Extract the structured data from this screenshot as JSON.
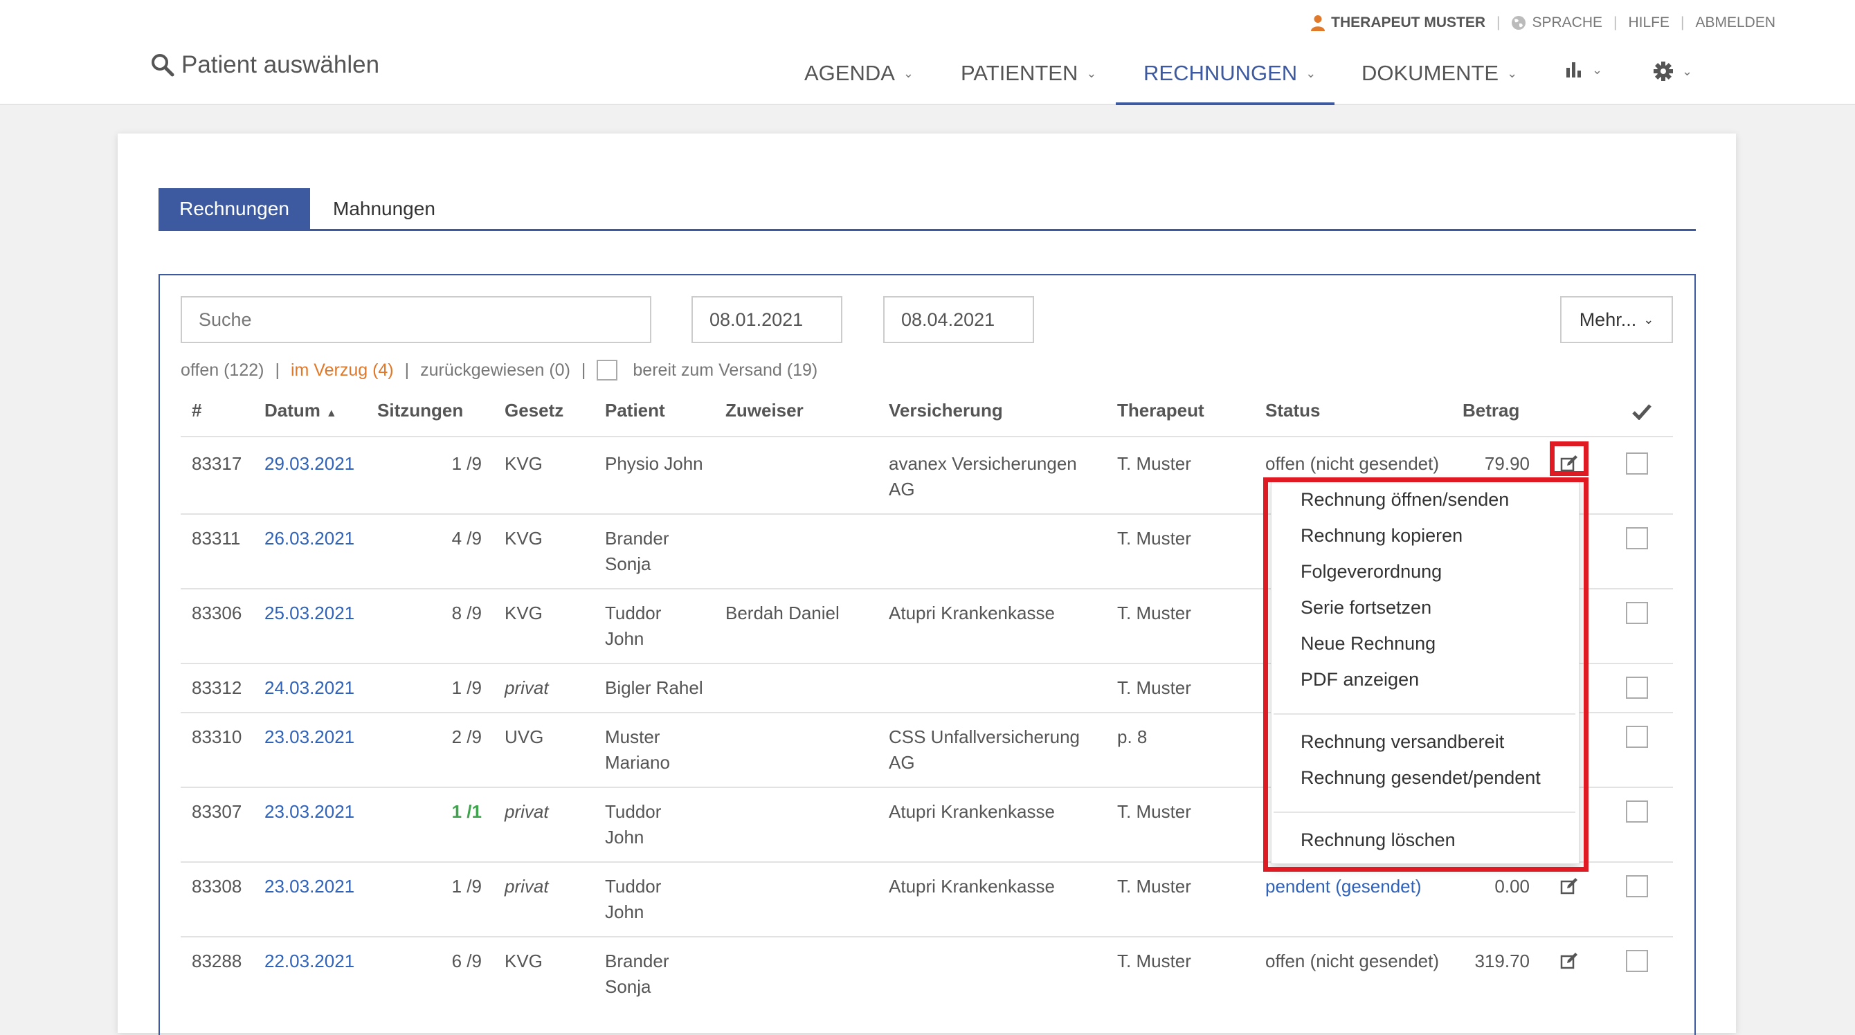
{
  "header": {
    "user": "THERAPEUT MUSTER",
    "language": "SPRACHE",
    "help": "HILFE",
    "logout": "ABMELDEN",
    "patient_select": "Patient auswählen",
    "nav": [
      "AGENDA",
      "PATIENTEN",
      "RECHNUNGEN",
      "DOKUMENTE"
    ],
    "active_nav": "RECHNUNGEN"
  },
  "tabs": [
    "Rechnungen",
    "Mahnungen"
  ],
  "toolbar": {
    "search_placeholder": "Suche",
    "date_from": "08.01.2021",
    "date_to": "08.04.2021",
    "more": "Mehr..."
  },
  "filters": {
    "open": "offen (122)",
    "overdue": "im Verzug (4)",
    "rejected": "zurückgewiesen (0)",
    "ready": "bereit zum Versand (19)",
    "sep": "|"
  },
  "table": {
    "columns": [
      "#",
      "Datum",
      "Sitzungen",
      "Gesetz",
      "Patient",
      "Zuweiser",
      "Versicherung",
      "Therapeut",
      "Status",
      "Betrag"
    ],
    "rows": [
      {
        "id": "83317",
        "date": "29.03.2021",
        "sessions": "1 /9",
        "law": "KVG",
        "patient": [
          "Physio John"
        ],
        "referrer": "",
        "insurance": [
          "avanex Versicherungen",
          "AG"
        ],
        "therapist": "T. Muster",
        "status": "offen (nicht gesendet)",
        "amount": "79.90"
      },
      {
        "id": "83311",
        "date": "26.03.2021",
        "sessions": "4 /9",
        "law": "KVG",
        "patient": [
          "Brander",
          "Sonja"
        ],
        "referrer": "",
        "insurance": [],
        "therapist": "T. Muster",
        "status": "",
        "amount": ""
      },
      {
        "id": "83306",
        "date": "25.03.2021",
        "sessions": "8 /9",
        "law": "KVG",
        "patient": [
          "Tuddor",
          "John"
        ],
        "referrer": "Berdah Daniel",
        "insurance": [
          "Atupri Krankenkasse"
        ],
        "therapist": "T. Muster",
        "status": "",
        "amount": ""
      },
      {
        "id": "83312",
        "date": "24.03.2021",
        "sessions": "1 /9",
        "law": "privat",
        "patient": [
          "Bigler Rahel"
        ],
        "referrer": "",
        "insurance": [],
        "therapist": "T. Muster",
        "status": "",
        "amount": ""
      },
      {
        "id": "83310",
        "date": "23.03.2021",
        "sessions": "2 /9",
        "law": "UVG",
        "patient": [
          "Muster",
          "Mariano"
        ],
        "referrer": "",
        "insurance": [
          "CSS Unfallversicherung",
          "AG"
        ],
        "therapist": "p. 8",
        "status": "",
        "amount": ""
      },
      {
        "id": "83307",
        "date": "23.03.2021",
        "sessions": "1 /1",
        "law": "privat",
        "patient": [
          "Tuddor",
          "John"
        ],
        "referrer": "",
        "insurance": [
          "Atupri Krankenkasse"
        ],
        "therapist": "T. Muster",
        "status": "",
        "amount": ""
      },
      {
        "id": "83308",
        "date": "23.03.2021",
        "sessions": "1 /9",
        "law": "privat",
        "patient": [
          "Tuddor",
          "John"
        ],
        "referrer": "",
        "insurance": [
          "Atupri Krankenkasse"
        ],
        "therapist": "T. Muster",
        "status": "pendent (gesendet)",
        "amount": "0.00"
      },
      {
        "id": "83288",
        "date": "22.03.2021",
        "sessions": "6 /9",
        "law": "KVG",
        "patient": [
          "Brander",
          "Sonja"
        ],
        "referrer": "",
        "insurance": [],
        "therapist": "T. Muster",
        "status": "offen (nicht gesendet)",
        "amount": "319.70"
      }
    ]
  },
  "menu": {
    "items": [
      "Rechnung öffnen/senden",
      "Rechnung kopieren",
      "Folgeverordnung",
      "Serie fortsetzen",
      "Neue Rechnung",
      "PDF anzeigen",
      "Rechnung versandbereit",
      "Rechnung gesendet/pendent",
      "Rechnung löschen"
    ]
  },
  "colors": {
    "primary": "#3d5aa0",
    "link": "#2f62b8",
    "warning": "#e0782a",
    "success": "#3ea44d",
    "highlight": "#e01a22"
  }
}
